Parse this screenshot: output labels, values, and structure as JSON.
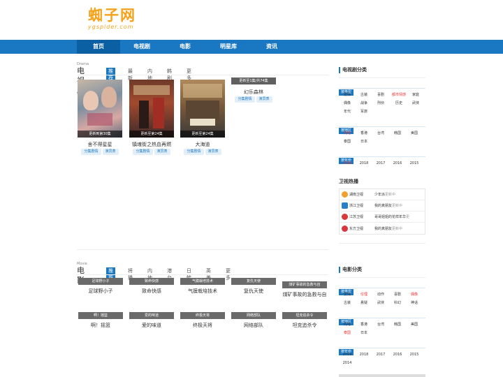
{
  "logo": {
    "main": "蜘子网",
    "sub": "ygspider.com"
  },
  "nav": [
    "首页",
    "电视剧",
    "电影",
    "明星库",
    "资讯"
  ],
  "tv": {
    "title": "电视剧",
    "en": "Drama",
    "tabs": [
      "推荐",
      "最新",
      "内地",
      "韩剧",
      "更多"
    ],
    "cards": [
      {
        "title": "舍不得星星",
        "cap": "更新到第30集",
        "tags": [
          "分集剧情",
          "演员表"
        ]
      },
      {
        "title": "镇魂街之热血再燃",
        "cap": "更新至第24集",
        "tags": [
          "分集剧情",
          "演员表"
        ]
      },
      {
        "title": "大海道",
        "cap": "更新至第24集",
        "tags": [
          "分集剧情",
          "演员表"
        ]
      },
      {
        "title": "幻乐森林",
        "cap": "更新至1集/共74集",
        "tags": [
          "分集剧情",
          "演员表"
        ]
      }
    ]
  },
  "movie": {
    "title": "电影",
    "en": "Movie",
    "tabs": [
      "推荐",
      "将播",
      "内地",
      "港台",
      "日韩",
      "英美",
      "更多"
    ],
    "row1": [
      {
        "bar": "足球野小子",
        "title": "足球野小子"
      },
      {
        "bar": "致命快感",
        "title": "致命快感"
      },
      {
        "bar": "气膜栽培技术",
        "title": "气膜栽培技术"
      },
      {
        "bar": "复仇天使",
        "title": "复仇天使"
      },
      {
        "bar": "煤矿事故的急救与自",
        "title": "煤矿事故的急救与自"
      }
    ],
    "row2": [
      {
        "bar": "啊！摇篮",
        "title": "啊！摇篮"
      },
      {
        "bar": "爱的味道",
        "title": "爱的味道"
      },
      {
        "bar": "终极天将",
        "title": "终极天将"
      },
      {
        "bar": "网络部队",
        "title": "网络部队"
      },
      {
        "bar": "坦克追杀令",
        "title": "坦克追杀令"
      }
    ]
  },
  "side_tv": {
    "title": "电视剧分类",
    "type_label": "按类型",
    "types": [
      "爱情",
      "古装",
      "喜剧",
      "都市情感",
      "家庭",
      "偶像",
      "战争",
      "刑侦",
      "历史",
      "武侠",
      "年代",
      "军旅"
    ],
    "area_label": "按地区",
    "areas": [
      "内地",
      "香港",
      "台湾",
      "韩国",
      "美国",
      "泰国",
      "日本"
    ],
    "year_label": "按年份",
    "years": [
      "2019",
      "2018",
      "2017",
      "2016",
      "2015"
    ]
  },
  "hot": {
    "title": "卫视热播",
    "rows": [
      {
        "name": "湖南卫视",
        "show": "少年派",
        "status": "更新中",
        "color": "#f0a030"
      },
      {
        "name": "浙江卫视",
        "show": "我的真朋友",
        "status": "更新中",
        "color": "#2a7fc9"
      },
      {
        "name": "江苏卫视",
        "show": "哥哥姐姐的花样年华",
        "status": "更",
        "color": "#d93a3a"
      },
      {
        "name": "东方卫视",
        "show": "我的真朋友",
        "status": "更新中",
        "color": "#d9363e"
      }
    ]
  },
  "side_movie": {
    "title": "电影分类",
    "type_label": "按类型",
    "types": [
      "爱情",
      "伦理",
      "动作",
      "喜剧",
      "偶像",
      "古装",
      "悬疑",
      "武侠",
      "科幻",
      "神话"
    ],
    "area_label": "按地区",
    "areas": [
      "内地",
      "香港",
      "台湾",
      "韩国",
      "美国",
      "泰国",
      "日本"
    ],
    "year_label": "按年份",
    "years": [
      "2019",
      "2018",
      "2017",
      "2016",
      "2015",
      "2014"
    ]
  },
  "colors": {
    "brand": "#1a78c2",
    "logo": "#f5a21b",
    "highlight": "#e33333"
  }
}
